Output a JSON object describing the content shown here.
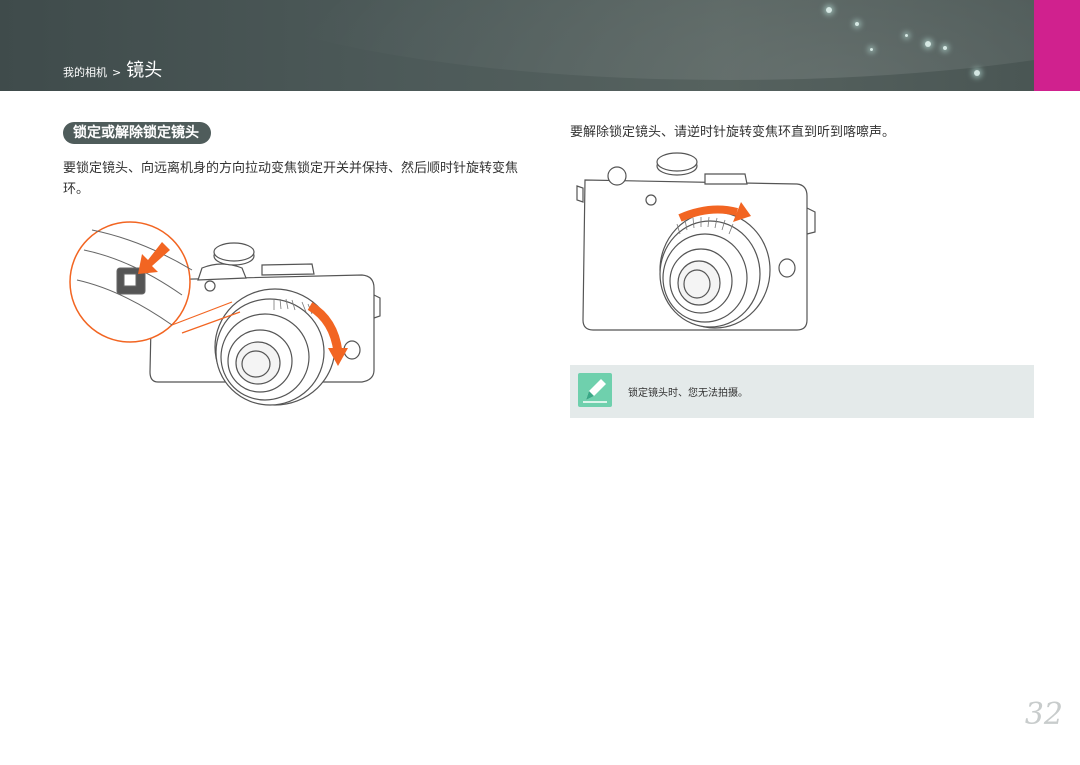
{
  "header": {
    "breadcrumb_parent": "我的相机",
    "breadcrumb_separator": ">",
    "breadcrumb_current": "镜头",
    "accent_color": "#d0218e",
    "header_color": "#4d5a59"
  },
  "section": {
    "title": "锁定或解除锁定镜头",
    "left_instruction": "要锁定镜头、向远离机身的方向拉动变焦锁定开关并保持、然后顺时针旋转变焦环。",
    "right_instruction": "要解除锁定镜头、请逆时针旋转变焦环直到听到喀嚓声。"
  },
  "illustrations": {
    "left": "camera-lock-zoom-ring-clockwise",
    "right": "camera-unlock-zoom-ring-counterclockwise",
    "arrow_color": "#f26522"
  },
  "note": {
    "icon": "pen-note-icon",
    "text": "锁定镜头时、您无法拍摄。"
  },
  "page": {
    "number": "32"
  }
}
